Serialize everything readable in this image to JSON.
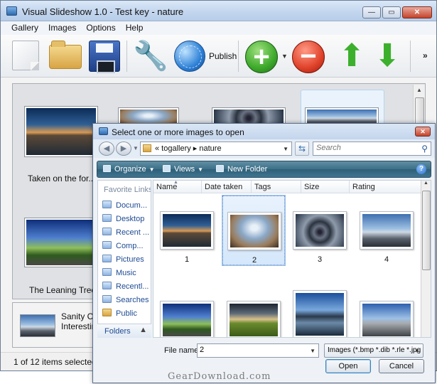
{
  "window": {
    "title": "Visual Slideshow 1.0 - Test key - nature",
    "minimize": "—",
    "maximize": "▭",
    "close": "✕"
  },
  "menu": [
    "Gallery",
    "Images",
    "Options",
    "Help"
  ],
  "toolbar": {
    "publish_label": "Publish",
    "more": "»",
    "icons": [
      "new-document-icon",
      "open-folder-icon",
      "save-disk-icon",
      "wrench-icon",
      "globe-icon",
      "add-icon",
      "remove-icon",
      "up-arrow-icon",
      "down-arrow-icon"
    ]
  },
  "gallery": {
    "captions": [
      "Taken on the for...",
      "The Leaning Tree"
    ]
  },
  "details": {
    "line1": "Sanity Ca",
    "line2": "Interestin"
  },
  "status": {
    "text": "1 of 12 items selected"
  },
  "dialog": {
    "title": "Select one or more images to open",
    "close": "✕",
    "path": "«  togallery  ▸  nature",
    "search_placeholder": "Search",
    "commands": {
      "organize": "Organize",
      "views": "Views",
      "new_folder": "New Folder"
    },
    "favorites_heading": "Favorite Links",
    "favorites": [
      "Docum...",
      "Desktop",
      "Recent ...",
      "Comp...",
      "Pictures",
      "Music",
      "Recentl...",
      "Searches",
      "Public"
    ],
    "folders_label": "Folders",
    "columns": [
      "Name",
      "Date taken",
      "Tags",
      "Size",
      "Rating"
    ],
    "files": [
      "1",
      "2",
      "3",
      "4"
    ],
    "filename_label": "File name:",
    "filename_value": "2",
    "filetype": "Images (*.bmp *.dib *.rle *.jpg",
    "open_button": "Open",
    "cancel_button": "Cancel"
  },
  "watermark": "GearDownload.com",
  "colors": {
    "titlebar": "#c3d6ee",
    "command_bar": "#3c6f88",
    "link_blue": "#1e4b93",
    "add_green": "#3da92a",
    "remove_red": "#e0422a"
  }
}
